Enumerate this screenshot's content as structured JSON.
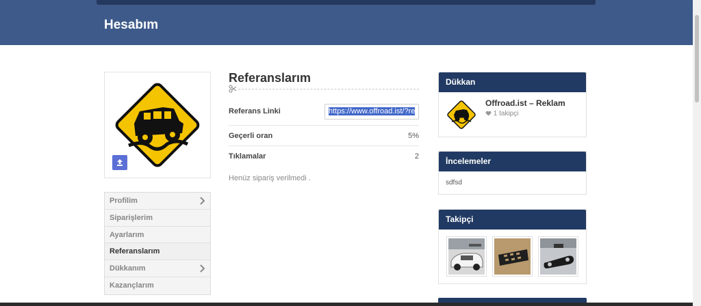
{
  "header": {
    "title": "Hesabım"
  },
  "sidebar": {
    "items": [
      {
        "label": "Profilim",
        "has_chevron": true
      },
      {
        "label": "Siparişlerim",
        "has_chevron": false
      },
      {
        "label": "Ayarlarım",
        "has_chevron": false
      },
      {
        "label": "Referanslarım",
        "has_chevron": false,
        "active": true
      },
      {
        "label": "Dükkanım",
        "has_chevron": true
      },
      {
        "label": "Kazançlarım",
        "has_chevron": false
      }
    ]
  },
  "referrals": {
    "title": "Referanslarım",
    "link_label": "Referans Linki",
    "link_value": "https://www.offroad.ist/?re",
    "rate_label": "Geçerli oran",
    "rate_value": "5%",
    "clicks_label": "Tıklamalar",
    "clicks_value": "2",
    "empty_message": "Henüz sipariş verilmedi ."
  },
  "widgets": {
    "store": {
      "title": "Dükkan",
      "name": "Offroad.ist – Reklam",
      "followers": "1 takipçi"
    },
    "reviews": {
      "title": "İncelemeler",
      "text": "sdfsd"
    },
    "followers": {
      "title": "Takipçi"
    }
  },
  "icons": {
    "upload": "upload-icon",
    "chevron": "chevron-right-icon",
    "scissors": "scissors-icon",
    "heart": "heart-icon"
  },
  "colors": {
    "header": "#3d5a8a",
    "widget_head": "#213a63",
    "upload_button": "#5b6fd6",
    "sign_yellow": "#f5c400"
  }
}
